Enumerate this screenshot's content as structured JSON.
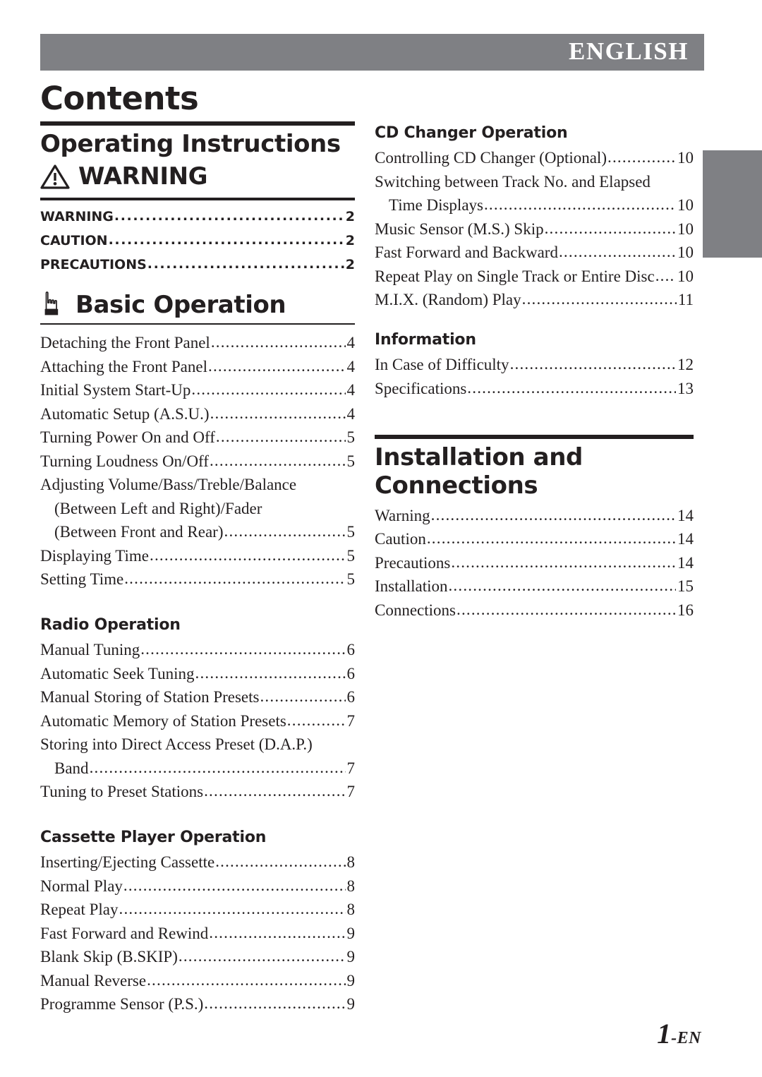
{
  "header": {
    "language_label": "ENGLISH",
    "band_color": "#7f8084"
  },
  "page_title": "Contents",
  "side_tab": {
    "name": "section-thumb-tab",
    "color": "#7f8084"
  },
  "footer": {
    "page_number": "1",
    "page_suffix": "-EN"
  },
  "left_column": {
    "part_title": "Operating Instructions",
    "warning_section": {
      "icon": "warning-triangle-icon",
      "heading": "WARNING",
      "items": [
        {
          "label": "WARNING",
          "page": "2"
        },
        {
          "label": "CAUTION",
          "page": "2"
        },
        {
          "label": "PRECAUTIONS",
          "page": "2"
        }
      ]
    },
    "basic_operation": {
      "icon": "pointing-hand-icon",
      "heading": "Basic Operation",
      "items": [
        {
          "label": "Detaching the Front Panel",
          "page": "4"
        },
        {
          "label": "Attaching the Front Panel",
          "page": "4"
        },
        {
          "label": "Initial System Start-Up",
          "page": "4"
        },
        {
          "label": "Automatic Setup (A.S.U.)",
          "page": "4"
        },
        {
          "label": "Turning Power On and Off",
          "page": "5"
        },
        {
          "label": "Turning Loudness On/Off",
          "page": "5"
        },
        {
          "label": "Adjusting Volume/Bass/Treble/Balance",
          "page": "",
          "continuation": true
        },
        {
          "label": "(Between Left and Right)/Fader",
          "page": "",
          "continuation": true,
          "indent": true
        },
        {
          "label": "(Between Front and Rear)",
          "page": "5",
          "indent": true
        },
        {
          "label": "Displaying Time",
          "page": "5"
        },
        {
          "label": "Setting Time",
          "page": "5"
        }
      ]
    },
    "radio_operation": {
      "heading": "Radio Operation",
      "items": [
        {
          "label": "Manual Tuning",
          "page": "6"
        },
        {
          "label": "Automatic Seek Tuning",
          "page": "6"
        },
        {
          "label": "Manual Storing of Station Presets",
          "page": "6"
        },
        {
          "label": "Automatic Memory of Station Presets",
          "page": "7"
        },
        {
          "label": "Storing into Direct Access Preset (D.A.P.)",
          "page": "",
          "continuation": true
        },
        {
          "label": "Band",
          "page": "7",
          "indent": true
        },
        {
          "label": "Tuning to Preset Stations",
          "page": "7"
        }
      ]
    },
    "cassette_player_operation": {
      "heading": "Cassette Player Operation",
      "items": [
        {
          "label": "Inserting/Ejecting Cassette",
          "page": "8"
        },
        {
          "label": "Normal Play",
          "page": "8"
        },
        {
          "label": "Repeat Play",
          "page": "8"
        },
        {
          "label": "Fast Forward and Rewind",
          "page": "9"
        },
        {
          "label": "Blank Skip (B.SKIP)",
          "page": "9"
        },
        {
          "label": "Manual Reverse",
          "page": "9"
        },
        {
          "label": "Programme Sensor (P.S.)",
          "page": "9"
        }
      ]
    }
  },
  "right_column": {
    "cd_changer_operation": {
      "heading": "CD Changer Operation",
      "items": [
        {
          "label": "Controlling CD Changer (Optional)",
          "page": "10"
        },
        {
          "label": "Switching between Track No. and Elapsed",
          "page": "",
          "continuation": true
        },
        {
          "label": "Time Displays",
          "page": "10",
          "indent": true
        },
        {
          "label": "Music Sensor (M.S.) Skip",
          "page": "10"
        },
        {
          "label": "Fast Forward and Backward",
          "page": "10"
        },
        {
          "label": "Repeat Play on Single Track or Entire Disc",
          "page": "10"
        },
        {
          "label": "M.I.X. (Random) Play",
          "page": "11"
        }
      ]
    },
    "information": {
      "heading": "Information",
      "items": [
        {
          "label": "In Case of Difficulty",
          "page": "12"
        },
        {
          "label": "Specifications",
          "page": "13"
        }
      ]
    },
    "installation_and_connections": {
      "part_title": "Installation and Connections",
      "items": [
        {
          "label": "Warning",
          "page": "14"
        },
        {
          "label": "Caution",
          "page": "14"
        },
        {
          "label": "Precautions",
          "page": "14"
        },
        {
          "label": "Installation",
          "page": "15"
        },
        {
          "label": "Connections",
          "page": "16"
        }
      ]
    }
  }
}
